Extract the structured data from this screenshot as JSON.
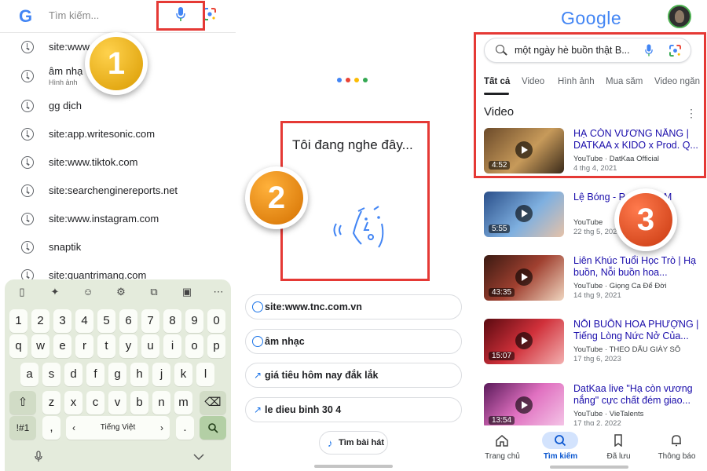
{
  "panel1": {
    "search": {
      "placeholder": "Tìm kiếm...",
      "logo": "G"
    },
    "history": [
      {
        "text": "site:www",
        "sub": ""
      },
      {
        "text": "âm nhạ",
        "sub": "Hình ảnh"
      },
      {
        "text": "gg dịch",
        "sub": ""
      },
      {
        "text": "site:app.writesonic.com",
        "sub": ""
      },
      {
        "text": "site:www.tiktok.com",
        "sub": ""
      },
      {
        "text": "site:searchenginereports.net",
        "sub": ""
      },
      {
        "text": "site:www.instagram.com",
        "sub": ""
      },
      {
        "text": "snaptik",
        "sub": ""
      },
      {
        "text": "site:quantrimang.com",
        "sub": ""
      }
    ],
    "badge": "1",
    "keyboard": {
      "toolbar": [
        "clipboard-icon",
        "sparkle-icon",
        "emoji-icon",
        "settings-icon",
        "translate-icon",
        "sticker-icon",
        "more-icon"
      ],
      "row_numbers": [
        "1",
        "2",
        "3",
        "4",
        "5",
        "6",
        "7",
        "8",
        "9",
        "0"
      ],
      "row_q": [
        "q",
        "w",
        "e",
        "r",
        "t",
        "y",
        "u",
        "i",
        "o",
        "p"
      ],
      "row_a": [
        "a",
        "s",
        "d",
        "f",
        "g",
        "h",
        "j",
        "k",
        "l"
      ],
      "row_z": [
        "z",
        "x",
        "c",
        "v",
        "b",
        "n",
        "m"
      ],
      "sym_key": "!#1",
      "comma_key": ",",
      "space_label": "Tiếng Việt",
      "period_key": "."
    }
  },
  "panel2": {
    "listening_text": "Tôi đang nghe đây...",
    "badge": "2",
    "suggestions": [
      {
        "icon": "history",
        "text": "site:www.tnc.com.vn"
      },
      {
        "icon": "history",
        "text": "âm nhạc"
      },
      {
        "icon": "trend",
        "text": "giá tiêu hôm nay đắk lắk"
      },
      {
        "icon": "trend",
        "text": "le dieu binh 30 4"
      }
    ],
    "song_search": "Tìm bài hát"
  },
  "panel3": {
    "logo": "Google",
    "query": "một ngày hè buồn thật B...",
    "tabs": [
      "Tất cả",
      "Video",
      "Hình ảnh",
      "Mua sắm",
      "Video ngắn"
    ],
    "section_title": "Video",
    "badge": "3",
    "videos": [
      {
        "title": "HẠ CÒN VƯƠNG NẮNG | DATKAA x KIDO x Prod. Q...",
        "source": "YouTube · DatKaa Official",
        "date": "4 thg 4, 2021",
        "duration": "4:52"
      },
      {
        "title": "Lệ Bóng - P (Official M",
        "source": "YouTube",
        "date": "22 thg 5, 202",
        "duration": "5:55"
      },
      {
        "title": "Liên Khúc Tuổi Học Trò | Hạ buồn, Nỗi buồn hoa...",
        "source": "YouTube · Giọng Ca Để Đời",
        "date": "14 thg 9, 2021",
        "duration": "43:35"
      },
      {
        "title": "NỖI BUỒN HOA PHƯỢNG | Tiếng Lòng Nức Nở Của...",
        "source": "YouTube · THEO DẤU GIÀY SỐ",
        "date": "17 thg 6, 2023",
        "duration": "15:07"
      },
      {
        "title": "DatKaa live \"Hạ còn vương nắng\" cực chất đém giao...",
        "source": "YouTube · VieTalents",
        "date": "17 thg 2, 2022",
        "duration": "13:54"
      }
    ],
    "nav": [
      "Trang chủ",
      "Tìm kiếm",
      "Đã lưu",
      "Thông báo"
    ]
  },
  "colors": {
    "highlight_red": "#e53935",
    "badge_1": "#e0a800",
    "badge_2": "#e58c00",
    "badge_3": "#e0451c",
    "link_blue": "#1a0dab",
    "google_blue": "#4285f4"
  }
}
